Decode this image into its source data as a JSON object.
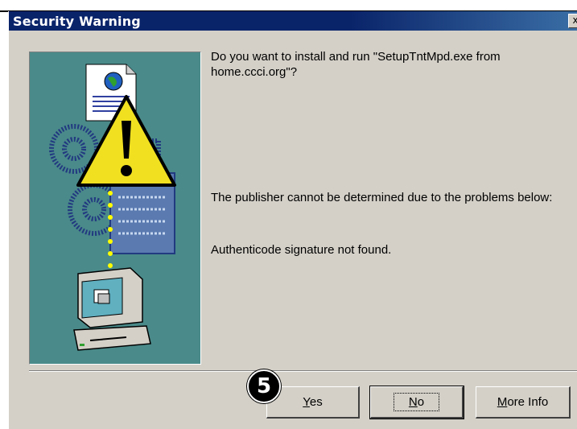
{
  "window": {
    "title": "Security Warning",
    "close_glyph": "x"
  },
  "message": {
    "question": "Do you want to install and run \"SetupTntMpd.exe from home.ccci.org\"?",
    "publisher_problem": "The publisher cannot be determined due to the problems below:",
    "detail": "Authenticode signature not found."
  },
  "buttons": {
    "yes": {
      "mnemonic": "Y",
      "rest": "es"
    },
    "no": {
      "mnemonic": "N",
      "rest": "o"
    },
    "more_info": {
      "mnemonic": "M",
      "rest": "ore Info"
    }
  },
  "annotation": {
    "step_number": "5"
  },
  "illustration": {
    "icons": [
      "document-globe-icon",
      "warning-triangle-icon",
      "keys-icon",
      "computer-icon"
    ],
    "colors": {
      "background": "#4a8a8a",
      "warning": "#f0e020",
      "dots": "#ffff00"
    }
  }
}
